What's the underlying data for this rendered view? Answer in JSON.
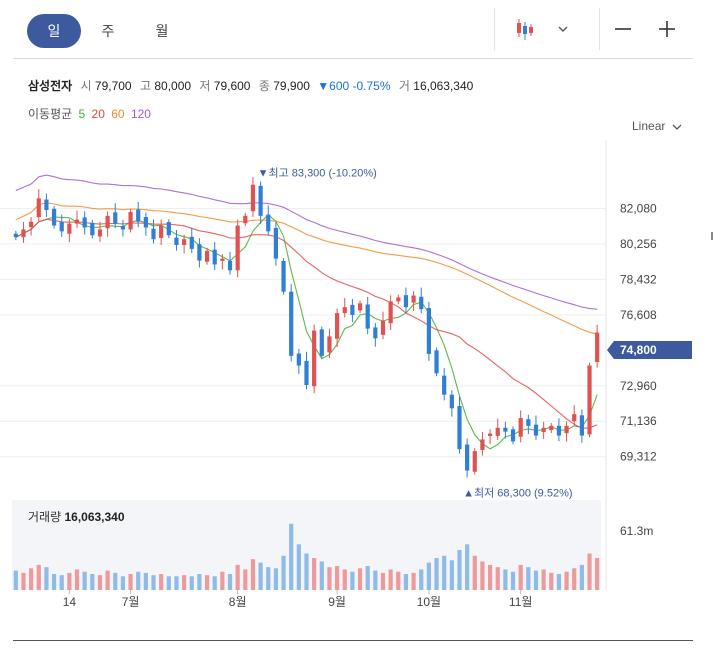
{
  "tabs": [
    {
      "label": "일",
      "active": true
    },
    {
      "label": "주",
      "active": false
    },
    {
      "label": "월",
      "active": false
    }
  ],
  "toolbar": {
    "chart_type_icon": "candlestick-icon",
    "dropdown_icon": "chevron-down-icon",
    "zoom_out_icon": "minus-icon",
    "zoom_in_icon": "plus-icon"
  },
  "stock": {
    "name": "삼성전자",
    "open_label": "시",
    "open": "79,700",
    "high_label": "고",
    "high": "80,000",
    "low_label": "저",
    "low": "79,600",
    "close_label": "종",
    "close": "79,900",
    "change": "▼600 -0.75%",
    "volume_label": "거",
    "volume": "16,063,340"
  },
  "moving_average": {
    "label": "이동평균",
    "periods": [
      {
        "label": "5",
        "color": "#3fae2a"
      },
      {
        "label": "20",
        "color": "#e24848"
      },
      {
        "label": "60",
        "color": "#f08a2c"
      },
      {
        "label": "120",
        "color": "#9b59d0"
      }
    ]
  },
  "scale_selector": "Linear",
  "colors": {
    "up": "#e05252",
    "down": "#2f7fd6",
    "current_price_tag": "#3d5a9e",
    "accent": "#3d5a9e"
  },
  "chart_data": {
    "type": "candlestick",
    "y_ticks": [
      "82,080",
      "80,256",
      "78,432",
      "76,608",
      "72,960",
      "71,136",
      "69,312"
    ],
    "y_tick_values": [
      82080,
      80256,
      78432,
      76608,
      72960,
      71136,
      69312
    ],
    "ylim": [
      67600,
      85600
    ],
    "x_tick_labels": [
      "14",
      "7월",
      "8월",
      "9월",
      "10월",
      "11월"
    ],
    "x_tick_index": [
      7,
      15,
      29,
      42,
      54,
      66
    ],
    "current_price_tag": "74,800",
    "current_price": 74800,
    "high_annotation": "▼최고 83,300 (-10.20%)",
    "high_annotation_index": 32,
    "high_value": 83300,
    "low_annotation": "▲최저 68,300 (9.52%)",
    "low_annotation_index": 59,
    "low_value": 68300,
    "closes": [
      80600,
      81000,
      81400,
      82600,
      82000,
      81200,
      80900,
      81300,
      81500,
      81100,
      80700,
      81000,
      81700,
      81300,
      81000,
      81900,
      81400,
      81100,
      80500,
      81200,
      80700,
      80200,
      80500,
      80000,
      79400,
      79900,
      79200,
      79500,
      78900,
      81200,
      81700,
      83300,
      81700,
      80900,
      79500,
      77800,
      74500,
      74000,
      73000,
      75800,
      74500,
      75500,
      76700,
      77000,
      76600,
      77200,
      75900,
      75400,
      76300,
      77300,
      77500,
      77000,
      77600,
      76900,
      74600,
      73600,
      72500,
      71800,
      69700,
      68600,
      69600,
      70200,
      70500,
      70800,
      70600,
      70100,
      71300,
      70900,
      70400,
      70800,
      70900,
      70400,
      70900,
      71500,
      70400,
      74000,
      75700
    ],
    "volume_max_label": "61.3m",
    "volume_title": "거래량",
    "volume_value": "16,063,340",
    "volumes_m": [
      17,
      15,
      19,
      22,
      20,
      14,
      13,
      15,
      18,
      16,
      14,
      13,
      17,
      15,
      12,
      14,
      16,
      15,
      13,
      14,
      12,
      12,
      13,
      12,
      14,
      13,
      12,
      16,
      14,
      22,
      18,
      27,
      24,
      20,
      19,
      30,
      58,
      40,
      32,
      28,
      25,
      20,
      21,
      18,
      16,
      19,
      21,
      17,
      15,
      18,
      16,
      14,
      15,
      18,
      24,
      28,
      30,
      26,
      35,
      40,
      30,
      25,
      22,
      20,
      18,
      16,
      22,
      20,
      17,
      18,
      15,
      14,
      16,
      19,
      22,
      32,
      28
    ]
  }
}
